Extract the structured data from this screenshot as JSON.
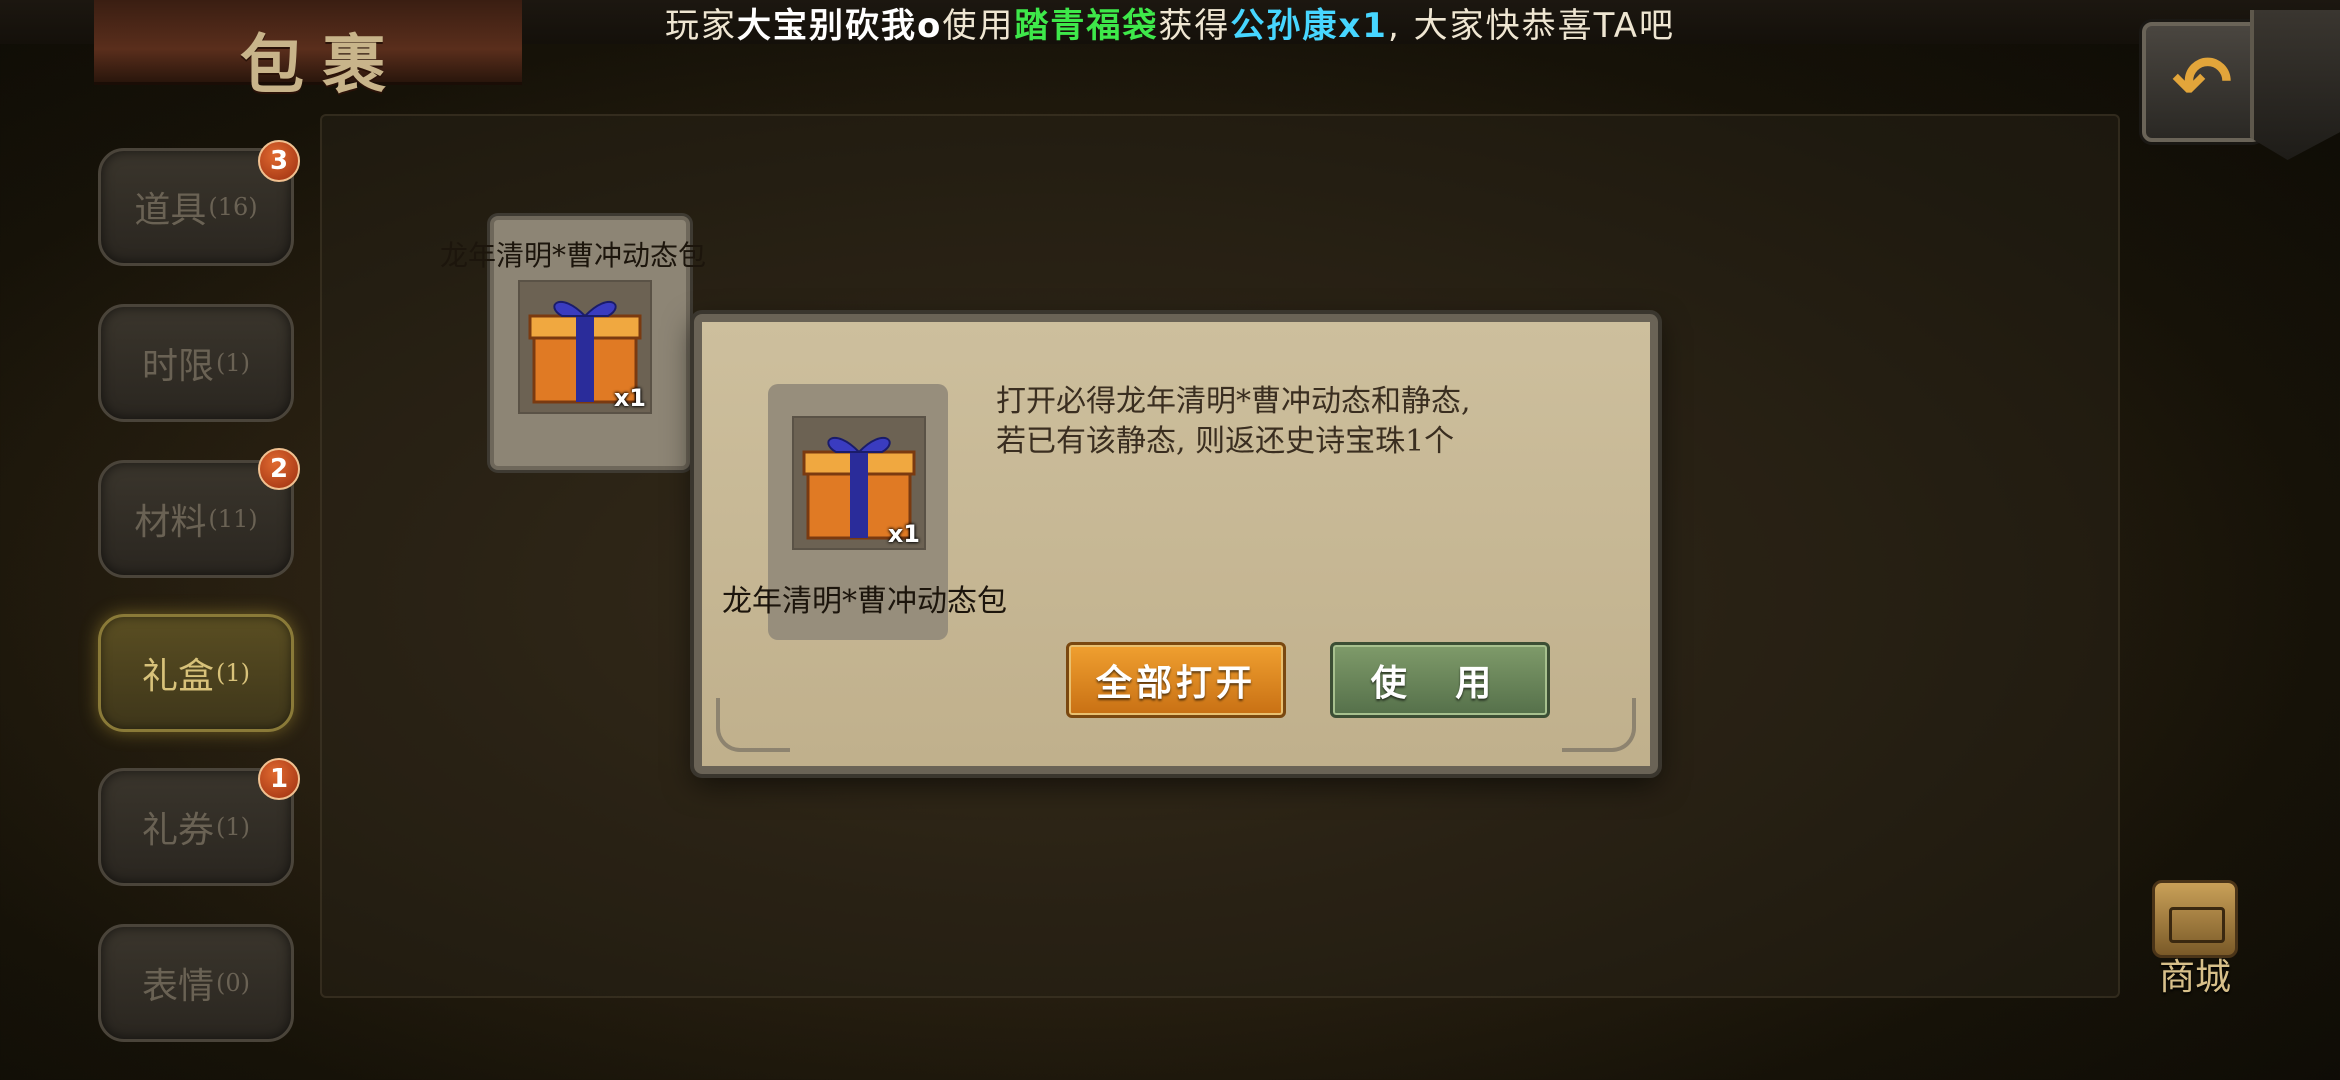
{
  "broadcast": {
    "prefix": "玩家",
    "player": "大宝别砍我o",
    "verb": "使用",
    "item": "踏青福袋",
    "got": "获得",
    "reward": "公孙康x1",
    "suffix": ", 大家快恭喜TA吧"
  },
  "title": "包裹",
  "colors": {
    "item_green": "#3ee84a",
    "reward_blue": "#47d6ff",
    "open_orange": "#e08c22",
    "use_green": "#6b8758"
  },
  "tabs": [
    {
      "label": "道具",
      "count": "(16)",
      "badge": "3",
      "active": false
    },
    {
      "label": "时限",
      "count": "(1)",
      "badge": "",
      "active": false
    },
    {
      "label": "材料",
      "count": "(11)",
      "badge": "2",
      "active": false
    },
    {
      "label": "礼盒",
      "count": "(1)",
      "badge": "",
      "active": true
    },
    {
      "label": "礼券",
      "count": "(1)",
      "badge": "1",
      "active": false
    },
    {
      "label": "表情",
      "count": "(0)",
      "badge": "",
      "active": false
    }
  ],
  "inventory": {
    "item_name": "龙年清明*曹冲动态包",
    "quantity": "x1",
    "icon": "gift-box-icon"
  },
  "dialog": {
    "item_name": "龙年清明*曹冲动态包",
    "quantity": "x1",
    "description_line1": "打开必得龙年清明*曹冲动态和静态,",
    "description_line2": "若已有该静态, 则返还史诗宝珠1个",
    "open_all_label": "全部打开",
    "use_label": "使 用"
  },
  "shop": {
    "label": "商城",
    "icon": "treasure-chest-icon"
  },
  "back_icon": "back-arrow-icon"
}
